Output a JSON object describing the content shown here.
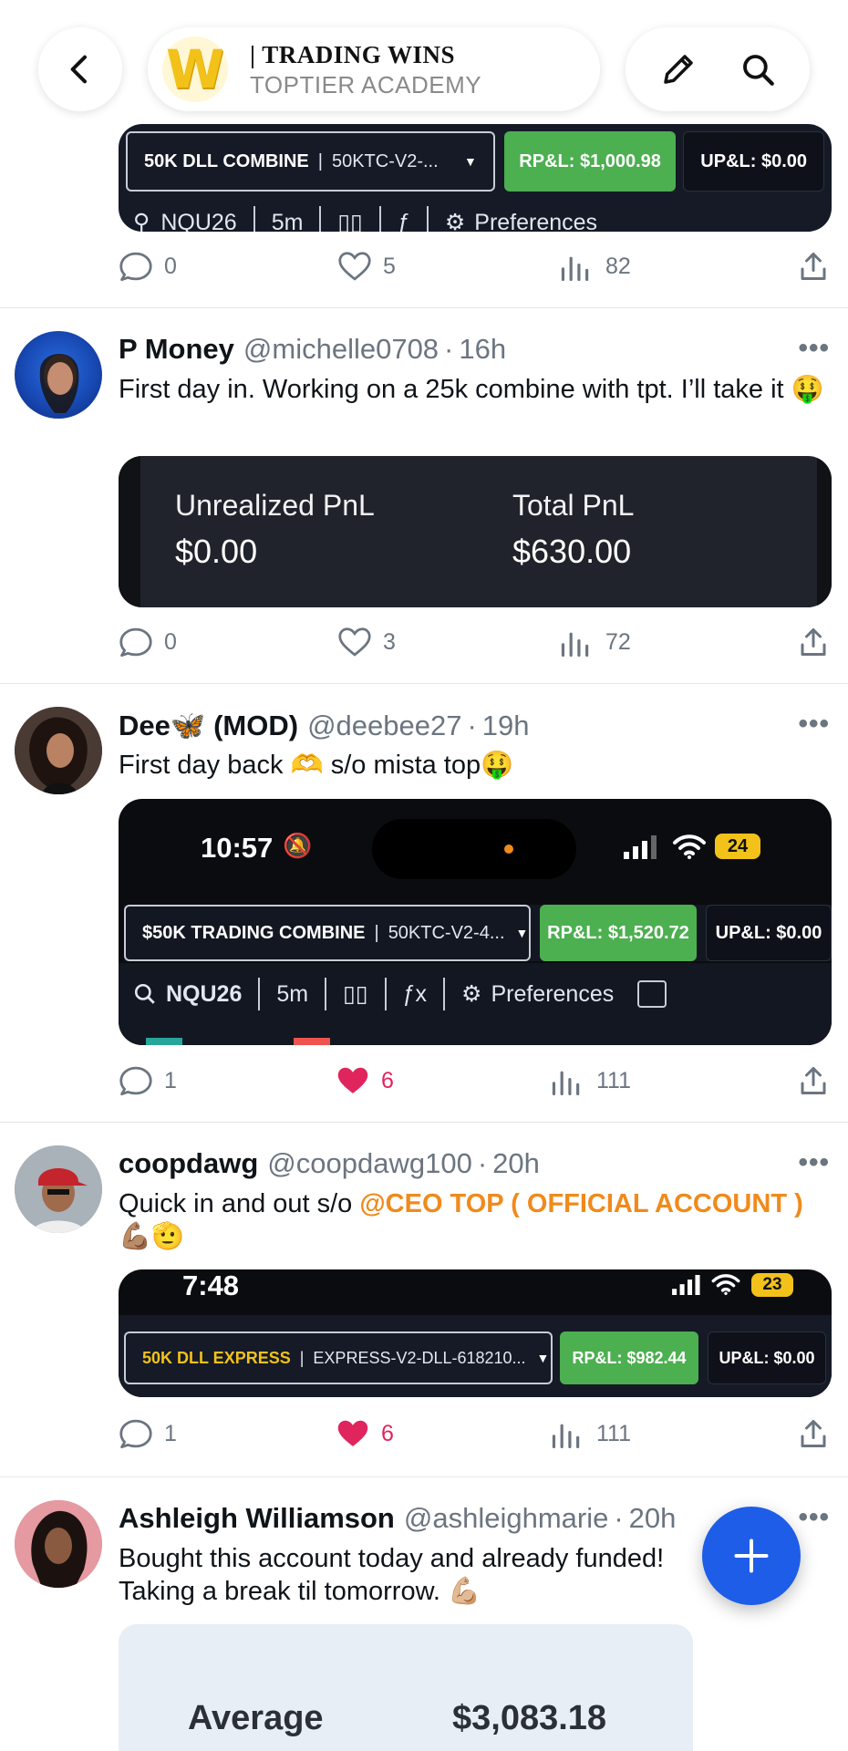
{
  "header": {
    "title": "| TRADING WINS",
    "subtitle": "TOPTIER ACADEMY",
    "logo_letter": "W"
  },
  "post0": {
    "widget": {
      "account": "50K DLL COMBINE",
      "account_id": "50KTC-V2-...",
      "rpl": "RP&L: $1,000.98",
      "upl": "UP&L: $0.00",
      "symbol": "NQU26",
      "interval": "5m",
      "prefs": "Preferences"
    },
    "actions": {
      "replies": "0",
      "likes": "5",
      "views": "82"
    }
  },
  "post1": {
    "name": "P Money",
    "handle": "@michelle0708",
    "dot": "·",
    "time": "16h",
    "text": "First day in. Working on a 25k combine with tpt. I’ll take it 🤑",
    "media": {
      "label1": "Unrealized PnL",
      "value1": "$0.00",
      "label2": "Total PnL",
      "value2": "$630.00"
    },
    "actions": {
      "replies": "0",
      "likes": "3",
      "views": "72"
    }
  },
  "post2": {
    "name": "Dee🦋 (MOD)",
    "handle": "@deebee27",
    "dot": "·",
    "time": "19h",
    "text": "First day back 🫶 s/o mista top🤑",
    "media": {
      "clock": "10:57",
      "battery": "24",
      "account": "$50K TRADING COMBINE",
      "account_id": "50KTC-V2-4...",
      "rpl": "RP&L: $1,520.72",
      "upl": "UP&L: $0.00",
      "symbol": "NQU26",
      "interval": "5m",
      "prefs": "Preferences"
    },
    "actions": {
      "replies": "1",
      "likes": "6",
      "views": "111"
    }
  },
  "post3": {
    "name": "coopdawg",
    "handle": "@coopdawg100",
    "dot": "·",
    "time": "20h",
    "text_prefix": "Quick in and out s/o ",
    "mention": "@CEO TOP ( OFFICIAL ACCOUNT )",
    "text_suffix": "💪🏽🫡",
    "media": {
      "clock": "7:48",
      "battery": "23",
      "account": "50K DLL EXPRESS",
      "account_id": "EXPRESS-V2-DLL-618210...",
      "rpl": "RP&L: $982.44",
      "upl": "UP&L: $0.00"
    },
    "actions": {
      "replies": "1",
      "likes": "6",
      "views": "111"
    }
  },
  "post4": {
    "name": "Ashleigh Williamson",
    "handle": "@ashleighmarie",
    "dot": "·",
    "time": "20h",
    "text": "Bought this account today and already funded! Taking a break til tomorrow. 💪🏼",
    "media": {
      "label": "Average",
      "value": "$3,083.18"
    }
  },
  "colors": {
    "accent_blue": "#1d5de8",
    "like_red": "#e0245e",
    "mention_orange": "#f08a1c",
    "pnl_green": "#4caf50"
  }
}
